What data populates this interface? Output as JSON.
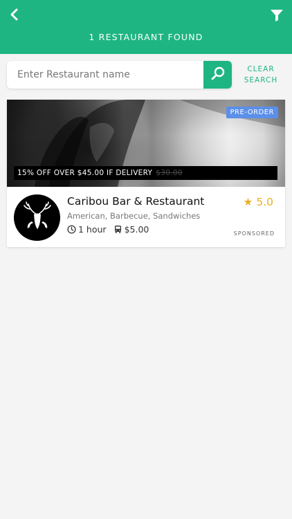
{
  "header": {
    "title": "1 RESTAURANT FOUND",
    "back_icon": "chevron-left-icon",
    "filter_icon": "filter-icon",
    "color": "#1eb583"
  },
  "search": {
    "placeholder": "Enter Restaurant name",
    "value": "",
    "button_icon": "search-icon",
    "clear_label_line1": "CLEAR",
    "clear_label_line2": "SEARCH"
  },
  "results": [
    {
      "name": "Caribou Bar & Restaurant",
      "cuisines": "American, Barbecue, Sandwiches",
      "delivery_time": "1 hour",
      "delivery_fee": "$5.00",
      "rating": "5.0",
      "badge": "PRE-ORDER",
      "promo": "15% OFF OVER $45.00 IF DELIVERY",
      "promo_old_price": "$30.00",
      "sponsored": "SPONSORED",
      "logo_icon": "deer-head-logo",
      "badge_color": "#5b8fe8",
      "rating_color": "#e9b122"
    }
  ]
}
